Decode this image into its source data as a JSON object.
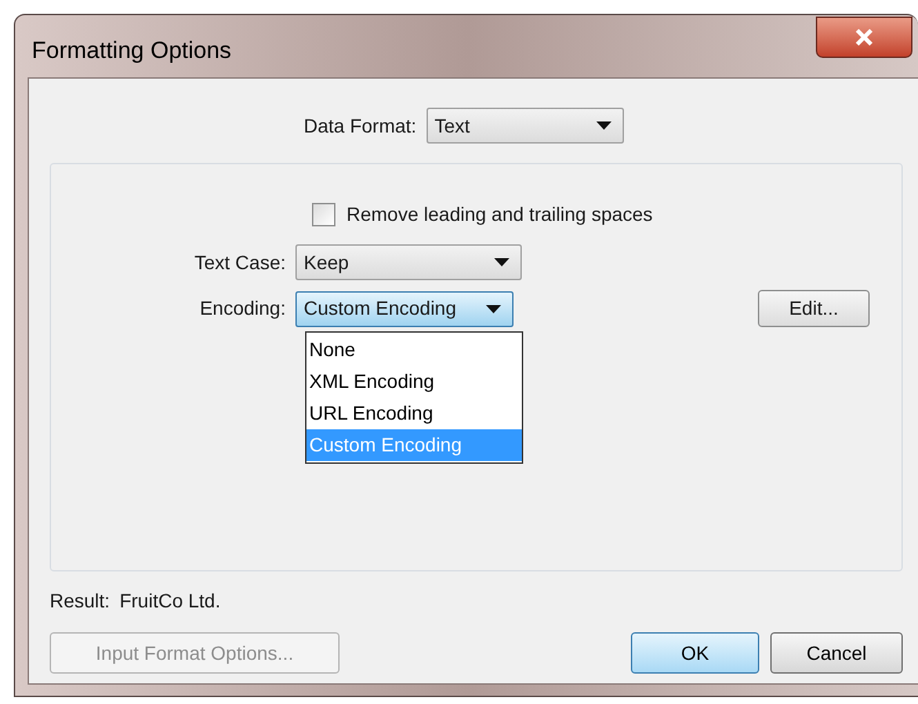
{
  "window": {
    "title": "Formatting Options"
  },
  "data_format": {
    "label": "Data Format:",
    "value": "Text"
  },
  "remove_spaces": {
    "label": "Remove leading and trailing spaces",
    "checked": false
  },
  "text_case": {
    "label": "Text Case:",
    "value": "Keep"
  },
  "encoding": {
    "label": "Encoding:",
    "value": "Custom Encoding",
    "expanded": true,
    "options": [
      {
        "label": "None",
        "selected": false
      },
      {
        "label": "XML Encoding",
        "selected": false
      },
      {
        "label": "URL Encoding",
        "selected": false
      },
      {
        "label": "Custom Encoding",
        "selected": true
      }
    ]
  },
  "edit_button": {
    "label": "Edit..."
  },
  "result": {
    "label": "Result:",
    "value": "FruitCo Ltd."
  },
  "buttons": [
    {
      "label": "Input Format Options...",
      "disabled": true,
      "default": false
    },
    {
      "label": "OK",
      "disabled": false,
      "default": true
    },
    {
      "label": "Cancel",
      "disabled": false,
      "default": false
    }
  ]
}
